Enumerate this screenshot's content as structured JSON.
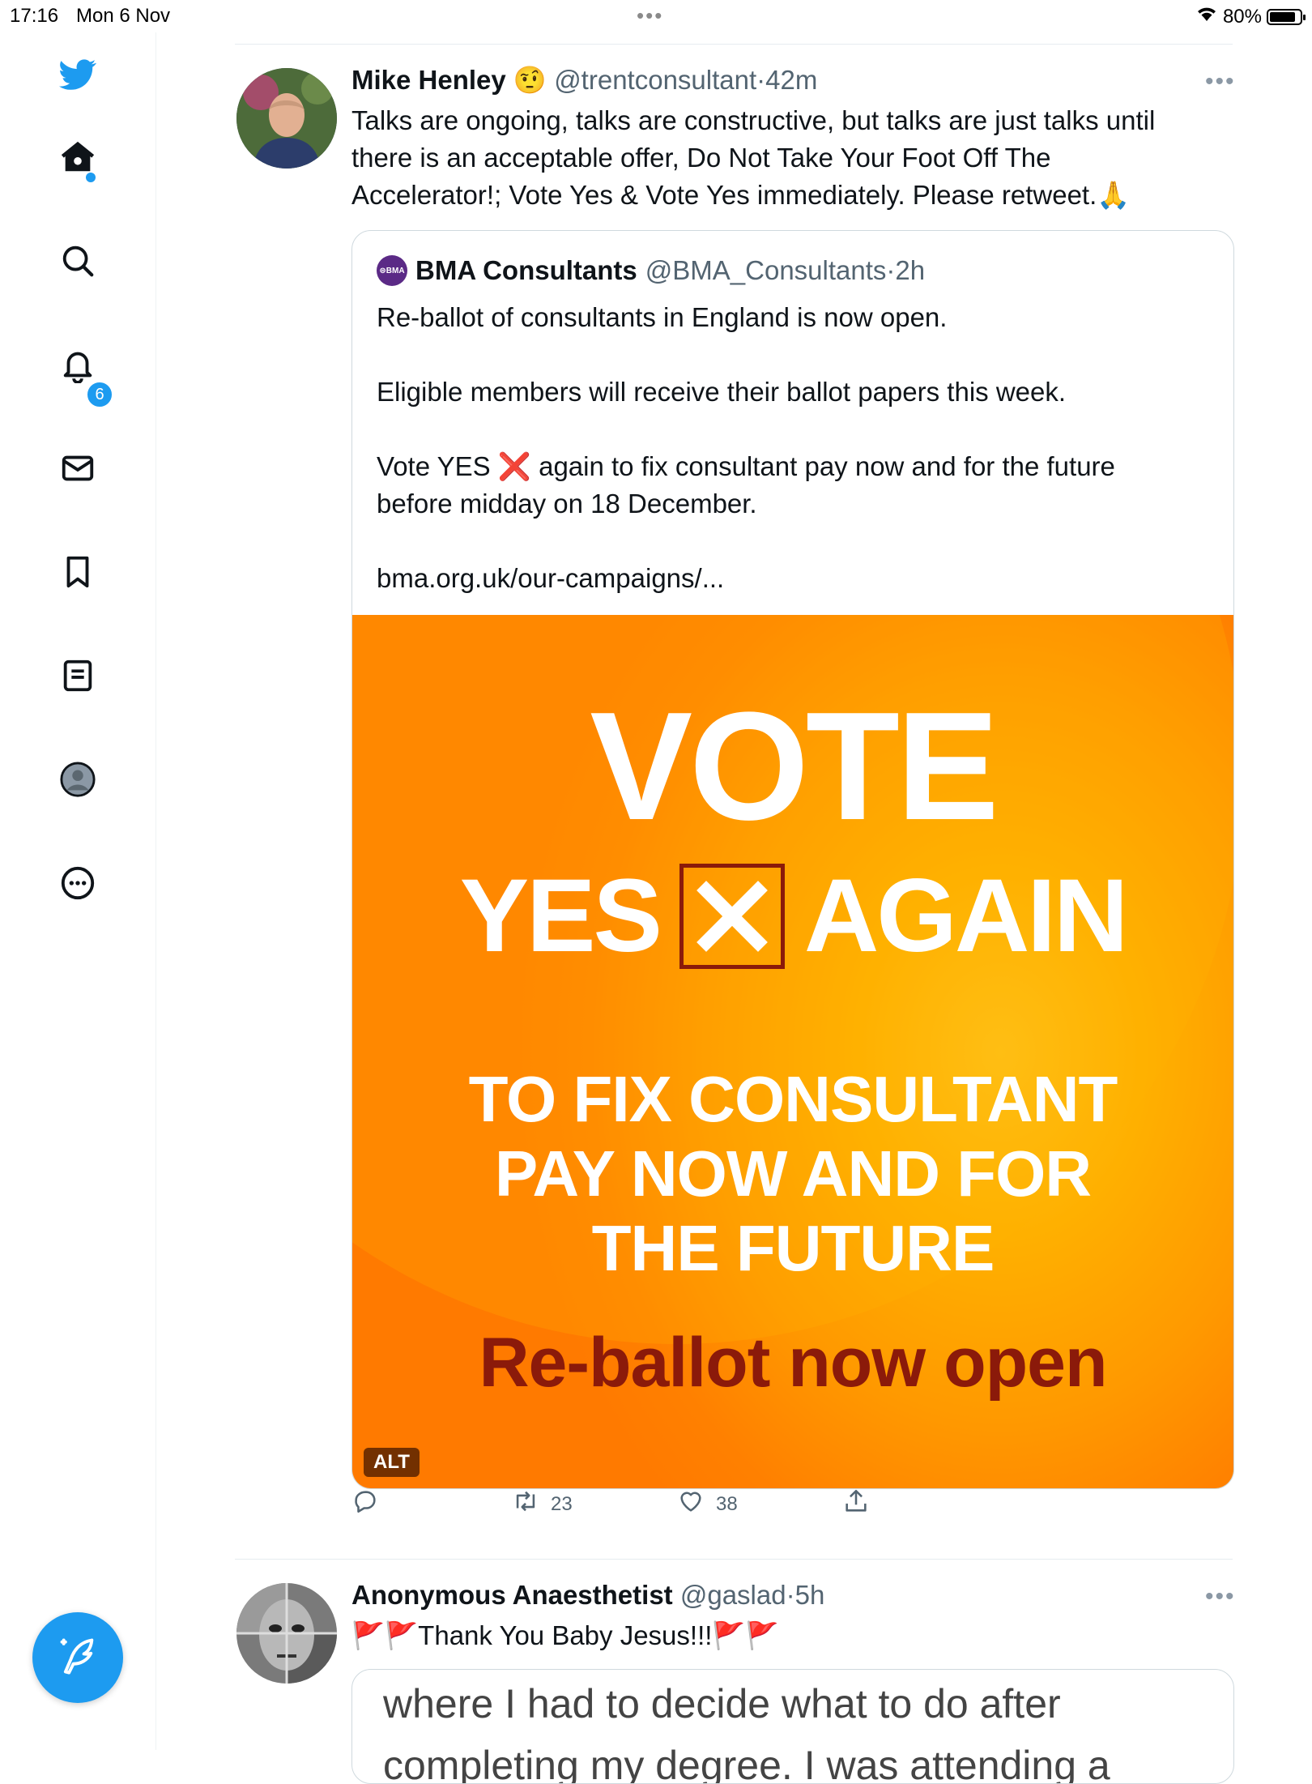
{
  "status_bar": {
    "time": "17:16",
    "date": "Mon 6 Nov",
    "dots": "•••",
    "battery": "80%"
  },
  "sidebar": {
    "items": [
      {
        "icon": "twitter-bird-icon"
      },
      {
        "icon": "home-icon"
      },
      {
        "icon": "search-icon"
      },
      {
        "icon": "bell-icon"
      },
      {
        "icon": "mail-icon"
      },
      {
        "icon": "bookmark-icon"
      },
      {
        "icon": "lists-icon"
      },
      {
        "icon": "profile-icon"
      },
      {
        "icon": "more-circle-icon"
      }
    ],
    "notifications_badge": "6",
    "compose_icon": "compose-feather-icon"
  },
  "tweet1": {
    "name": "Mike Henley",
    "emoji": "🤨",
    "handle": "@trentconsultant",
    "sep": "·",
    "time": "42m",
    "more": "•••",
    "text_line1": "Talks are ongoing, talks are constructive, but talks are just talks until",
    "text_line2": "there is an acceptable offer, Do Not Take Your Foot Off The",
    "text_line3": "Accelerator!; Vote Yes & Vote Yes immediately. Please retweet.🙏",
    "quote": {
      "logo": "⊜BMA",
      "name": "BMA Consultants",
      "handle": "@BMA_Consultants",
      "sep": "·",
      "time": "2h",
      "p1": "Re-ballot of consultants in England is now open.",
      "p2": "Eligible members will receive their ballot papers this week.",
      "p3_before": "Vote YES ",
      "p3_x": "❌",
      "p3_after": " again to fix consultant pay now and for the future",
      "p3_line2": "before midday on 18 December.",
      "p4": "bma.org.uk/our-campaigns/...",
      "image": {
        "vote": "VOTE",
        "yes": "YES",
        "again": "AGAIN",
        "fix1": "TO FIX CONSULTANT",
        "fix2": "PAY NOW AND FOR",
        "fix3": "THE FUTURE",
        "reballot": "Re-ballot now open",
        "alt": "ALT"
      }
    },
    "actions": {
      "retweets": "23",
      "likes": "38"
    }
  },
  "tweet2": {
    "name": "Anonymous Anaesthetist",
    "handle": "@gaslad",
    "sep": "·",
    "time": "5h",
    "more": "•••",
    "text": "🚩🚩Thank You Baby Jesus!!!🚩🚩",
    "quote_line1": "where I had to decide what to do after",
    "quote_line2": "completing my degree. I was attending a"
  },
  "colors": {
    "accent": "#1d9bf0",
    "text": "#0f1419",
    "meta": "#536471",
    "orange": "#ff8c00",
    "maroon": "#8b1a0a"
  }
}
